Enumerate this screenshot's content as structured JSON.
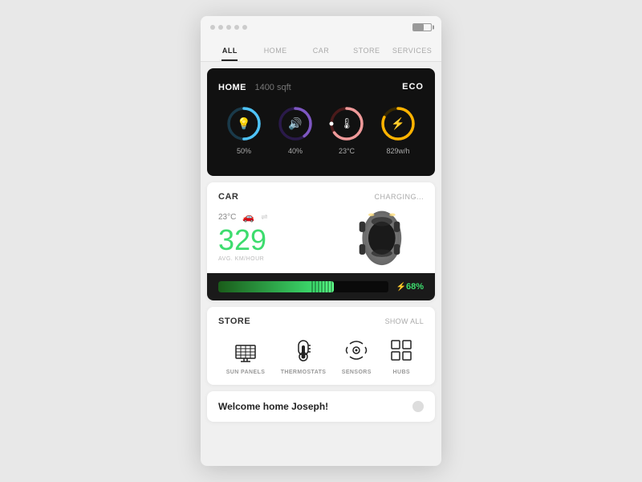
{
  "status_bar": {
    "battery_label": "battery"
  },
  "nav": {
    "tabs": [
      "ALL",
      "HOME",
      "CAR",
      "STORE",
      "SERVICES"
    ],
    "active_index": 0
  },
  "home_card": {
    "title": "HOME",
    "sqft": "1400 sqft",
    "badge": "ECO",
    "gauges": [
      {
        "icon": "💡",
        "value": "50%",
        "percent": 50,
        "color": "#4fc3f7",
        "track": "#1a3a4a"
      },
      {
        "icon": "🔊",
        "value": "40%",
        "percent": 40,
        "color": "#7e57c2",
        "track": "#2a1a4a"
      },
      {
        "icon": "🌡",
        "value": "23°C",
        "percent": 65,
        "color": "#ef9a9a",
        "track": "#4a1a1a"
      },
      {
        "icon": "⚡",
        "value": "829w/h",
        "percent": 82,
        "color": "#ffb300",
        "track": "#3a2a00"
      }
    ]
  },
  "car_card": {
    "label": "CAR",
    "status": "CHARGING...",
    "temperature": "23°C",
    "speed": "329",
    "speed_unit": "AVG. KM/HOUR",
    "battery_percent": "68%",
    "battery_bolt": "⚡"
  },
  "store_card": {
    "label": "STORE",
    "action": "SHOW ALL",
    "items": [
      {
        "icon": "☀",
        "label": "SUN PANELS"
      },
      {
        "icon": "🌡",
        "label": "THERMOSTATS"
      },
      {
        "icon": "📡",
        "label": "SENSORS"
      },
      {
        "icon": "🔲",
        "label": "HUBS"
      }
    ]
  },
  "welcome_bar": {
    "text": "Welcome home Joseph!"
  }
}
